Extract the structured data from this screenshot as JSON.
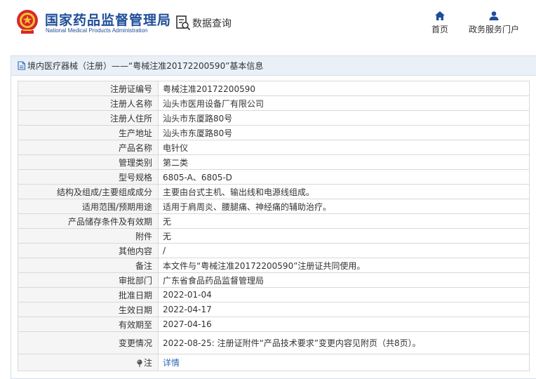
{
  "header": {
    "site_name_cn": "国家药品监督管理局",
    "site_name_en": "National Medical Products Administration",
    "query_label": "数据查询",
    "nav": [
      {
        "label": "首页",
        "icon": "home-icon"
      },
      {
        "label": "政务服务门户",
        "icon": "user-icon"
      }
    ]
  },
  "panel": {
    "title": "境内医疗器械（注册）——“粤械注准20172200590”基本信息"
  },
  "rows": [
    {
      "key": "注册证编号",
      "value": "粤械注准20172200590"
    },
    {
      "key": "注册人名称",
      "value": "汕头市医用设备厂有限公司"
    },
    {
      "key": "注册人住所",
      "value": "汕头市东厦路80号"
    },
    {
      "key": "生产地址",
      "value": "汕头市东厦路80号"
    },
    {
      "key": "产品名称",
      "value": "电针仪"
    },
    {
      "key": "管理类别",
      "value": "第二类"
    },
    {
      "key": "型号规格",
      "value": "6805-A、6805-D"
    },
    {
      "key": "结构及组成/主要组成成分",
      "value": "主要由台式主机、输出线和电源线组成。"
    },
    {
      "key": "适用范围/预期用途",
      "value": "适用于肩周炎、腰腿痛、神经痛的辅助治疗。"
    },
    {
      "key": "产品储存条件及有效期",
      "value": "无"
    },
    {
      "key": "附件",
      "value": "无"
    },
    {
      "key": "其他内容",
      "value": "/"
    },
    {
      "key": "备注",
      "value": "本文件与“粤械注准20172200590”注册证共同使用。"
    },
    {
      "key": "审批部门",
      "value": "广东省食品药品监督管理局"
    },
    {
      "key": "批准日期",
      "value": "2022-01-04"
    },
    {
      "key": "生效日期",
      "value": "2022-04-17"
    },
    {
      "key": "有效期至",
      "value": "2027-04-16"
    },
    {
      "key": "变更情况",
      "value": "2022-08-25: 注册证附件“产品技术要求”变更内容见附页（共8页）。"
    }
  ],
  "note_row": {
    "key": "注",
    "icon": "pin-icon",
    "link": "详情"
  },
  "colors": {
    "brand": "#1f4e99",
    "accent_red": "#d8262c",
    "link": "#2d6ab3",
    "panel_title_bg": "#eaf0f8"
  }
}
